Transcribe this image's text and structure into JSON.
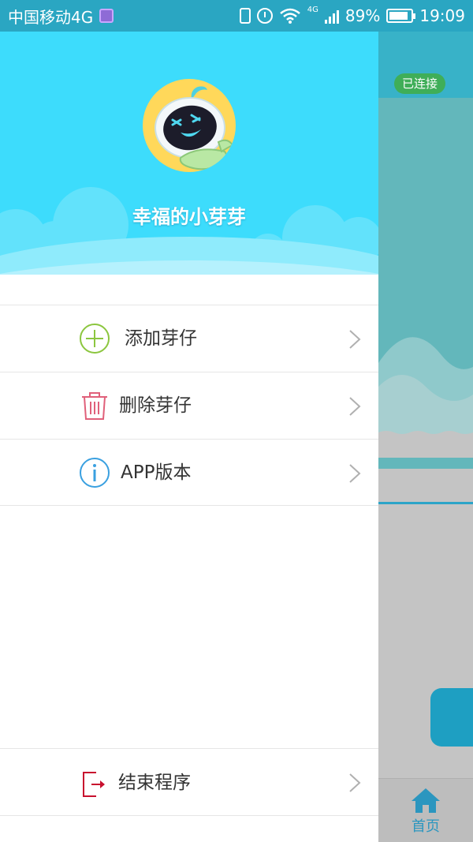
{
  "status_bar": {
    "carrier": "中国移动4G",
    "network_type": "4G",
    "battery": "89%",
    "time": "19:09"
  },
  "background_app": {
    "connection_badge": "已连接",
    "home_tab_label": "首页"
  },
  "drawer": {
    "username": "幸福的小芽芽",
    "menu_items": [
      {
        "label": "添加芽仔",
        "icon": "add-circle-icon"
      },
      {
        "label": "删除芽仔",
        "icon": "trash-icon"
      },
      {
        "label": "APP版本",
        "icon": "info-icon"
      }
    ],
    "exit_item": {
      "label": "结束程序",
      "icon": "exit-icon"
    }
  },
  "colors": {
    "header_bg": "#3ddcfc",
    "add_icon": "#8cc63f",
    "delete_icon": "#e0607a",
    "info_icon": "#3aa0e0",
    "exit_icon": "#c8102e",
    "connected_badge": "#3fae58",
    "tab_active": "#2b96bf"
  }
}
